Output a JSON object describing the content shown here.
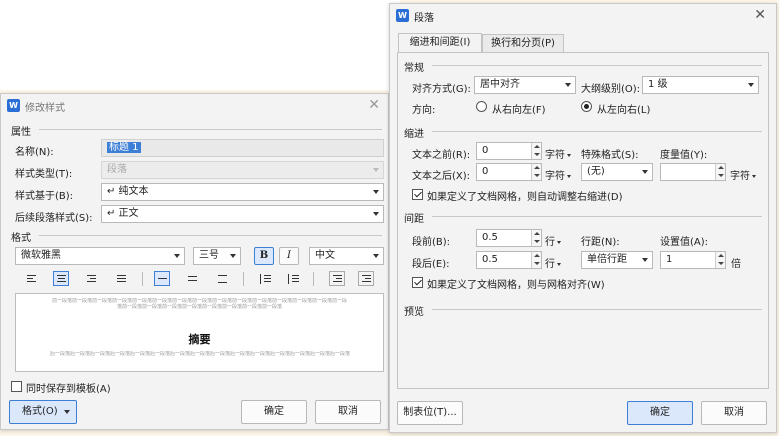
{
  "modify_style": {
    "title": "修改样式",
    "props_heading": "属性",
    "name_label": "名称(N):",
    "name_value": "标题 1",
    "type_label": "样式类型(T):",
    "type_value": "段落",
    "based_label": "样式基于(B):",
    "based_value": "↵ 纯文本",
    "follow_label": "后续段落样式(S):",
    "follow_value": "↵ 正文",
    "format_heading": "格式",
    "font": "微软雅黑",
    "size": "三号",
    "bold": "B",
    "italic": "I",
    "lang": "中文",
    "preview_prev": "前一段落前一段落前一段落前一段落前一段落前一段落前一段落前一段落前一段落前一段落前一段落前一段落前一段落前一段落前一段落前一段落前一段落前一段落前一段落前一段落前一段落前一段落前一段落",
    "preview_title": "摘要",
    "preview_next": "后一段落后一段落后一段落后一段落后一段落后一段落后一段落后一段落后一段落后一段落后一段落后一段落后一段落后一段落后一段落",
    "save_template": "同时保存到模板(A)",
    "format_btn": "格式(O)",
    "ok": "确定",
    "cancel": "取消"
  },
  "paragraph": {
    "title": "段落",
    "tabs": [
      "缩进和间距(I)",
      "换行和分页(P)"
    ],
    "general_heading": "常规",
    "align_label": "对齐方式(G):",
    "align_value": "居中对齐",
    "outline_label": "大纲级别(O):",
    "outline_value": "1 级",
    "direction_label": "方向:",
    "rtl_label": "从右向左(F)",
    "ltr_label": "从左向右(L)",
    "indent_heading": "缩进",
    "before_text_label": "文本之前(R):",
    "before_text_value": "0",
    "after_text_label": "文本之后(X):",
    "after_text_value": "0",
    "unit_char": "字符",
    "special_label": "特殊格式(S):",
    "special_value": "(无)",
    "measure_label": "度量值(Y):",
    "measure_value": "",
    "auto_indent": "如果定义了文档网格，则自动调整右缩进(D)",
    "spacing_heading": "间距",
    "space_before_label": "段前(B):",
    "space_before_value": "0.5",
    "space_after_label": "段后(E):",
    "space_after_value": "0.5",
    "unit_line": "行",
    "line_spacing_label": "行距(N):",
    "line_spacing_value": "单倍行距",
    "set_value_label": "设置值(A):",
    "set_value": "1",
    "unit_times": "倍",
    "snap_grid": "如果定义了文档网格，则与网格对齐(W)",
    "preview_heading": "预览",
    "tabs_btn": "制表位(T)...",
    "ok": "确定",
    "cancel": "取消"
  },
  "colors": {
    "accent": "#3d7ed6",
    "logo": "#2b6fd6"
  },
  "icons": [
    "wps-logo-icon",
    "close-icon",
    "chevron-down-icon",
    "align-left-icon",
    "align-center-icon",
    "align-right-icon",
    "justify-icon"
  ]
}
